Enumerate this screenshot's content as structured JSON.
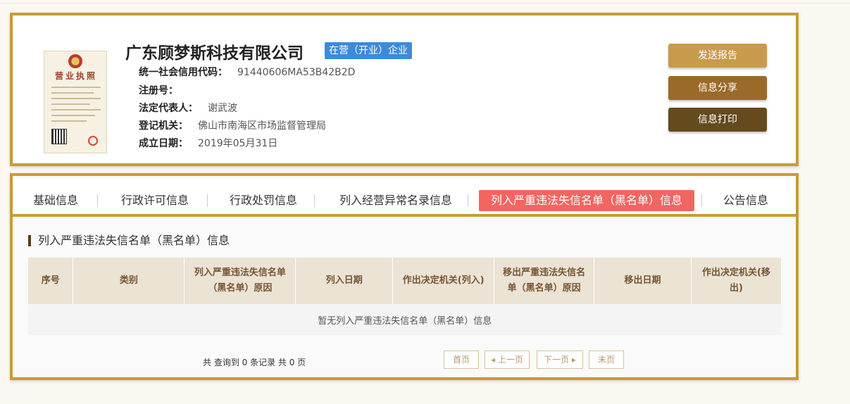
{
  "company": {
    "name": "广东顾梦斯科技有限公司",
    "status": "在营（开业）企业",
    "license_image": {
      "title": "营业执照"
    },
    "fields": [
      {
        "label": "统一社会信用代码：",
        "value": "91440606MA53B42B2D"
      },
      {
        "label": "注册号：",
        "value": ""
      },
      {
        "label": "法定代表人：",
        "value": "谢武波"
      },
      {
        "label": "登记机关：",
        "value": "佛山市南海区市场监督管理局"
      },
      {
        "label": "成立日期：",
        "value": "2019年05月31日"
      }
    ]
  },
  "actions": {
    "send_report": "发送报告",
    "share": "信息分享",
    "print": "信息打印"
  },
  "tabs": [
    {
      "label": "基础信息",
      "active": false
    },
    {
      "label": "行政许可信息",
      "active": false
    },
    {
      "label": "行政处罚信息",
      "active": false
    },
    {
      "label": "列入经营异常名录信息",
      "active": false
    },
    {
      "label": "列入严重违法失信名单（黑名单）信息",
      "active": true
    },
    {
      "label": "公告信息",
      "active": false
    }
  ],
  "section": {
    "title": "列入严重违法失信名单（黑名单）信息",
    "columns": [
      "序号",
      "类别",
      "列入严重违法失信名单（黑名单）原因",
      "列入日期",
      "作出决定机关(列入)",
      "移出严重违法失信名单（黑名单）原因",
      "移出日期",
      "作出决定机关(移出)"
    ],
    "empty_message": "暂无列入严重违法失信名单（黑名单）信息",
    "summary": "共 查询到 0 条记录 共 0 页"
  },
  "pagination": {
    "first": "首页",
    "prev": "上一页",
    "next": "下一页",
    "last": "末页"
  },
  "colors": {
    "gold_border": "#c99b36",
    "status_badge": "#3a8bdc",
    "active_tab": "#f26561"
  }
}
